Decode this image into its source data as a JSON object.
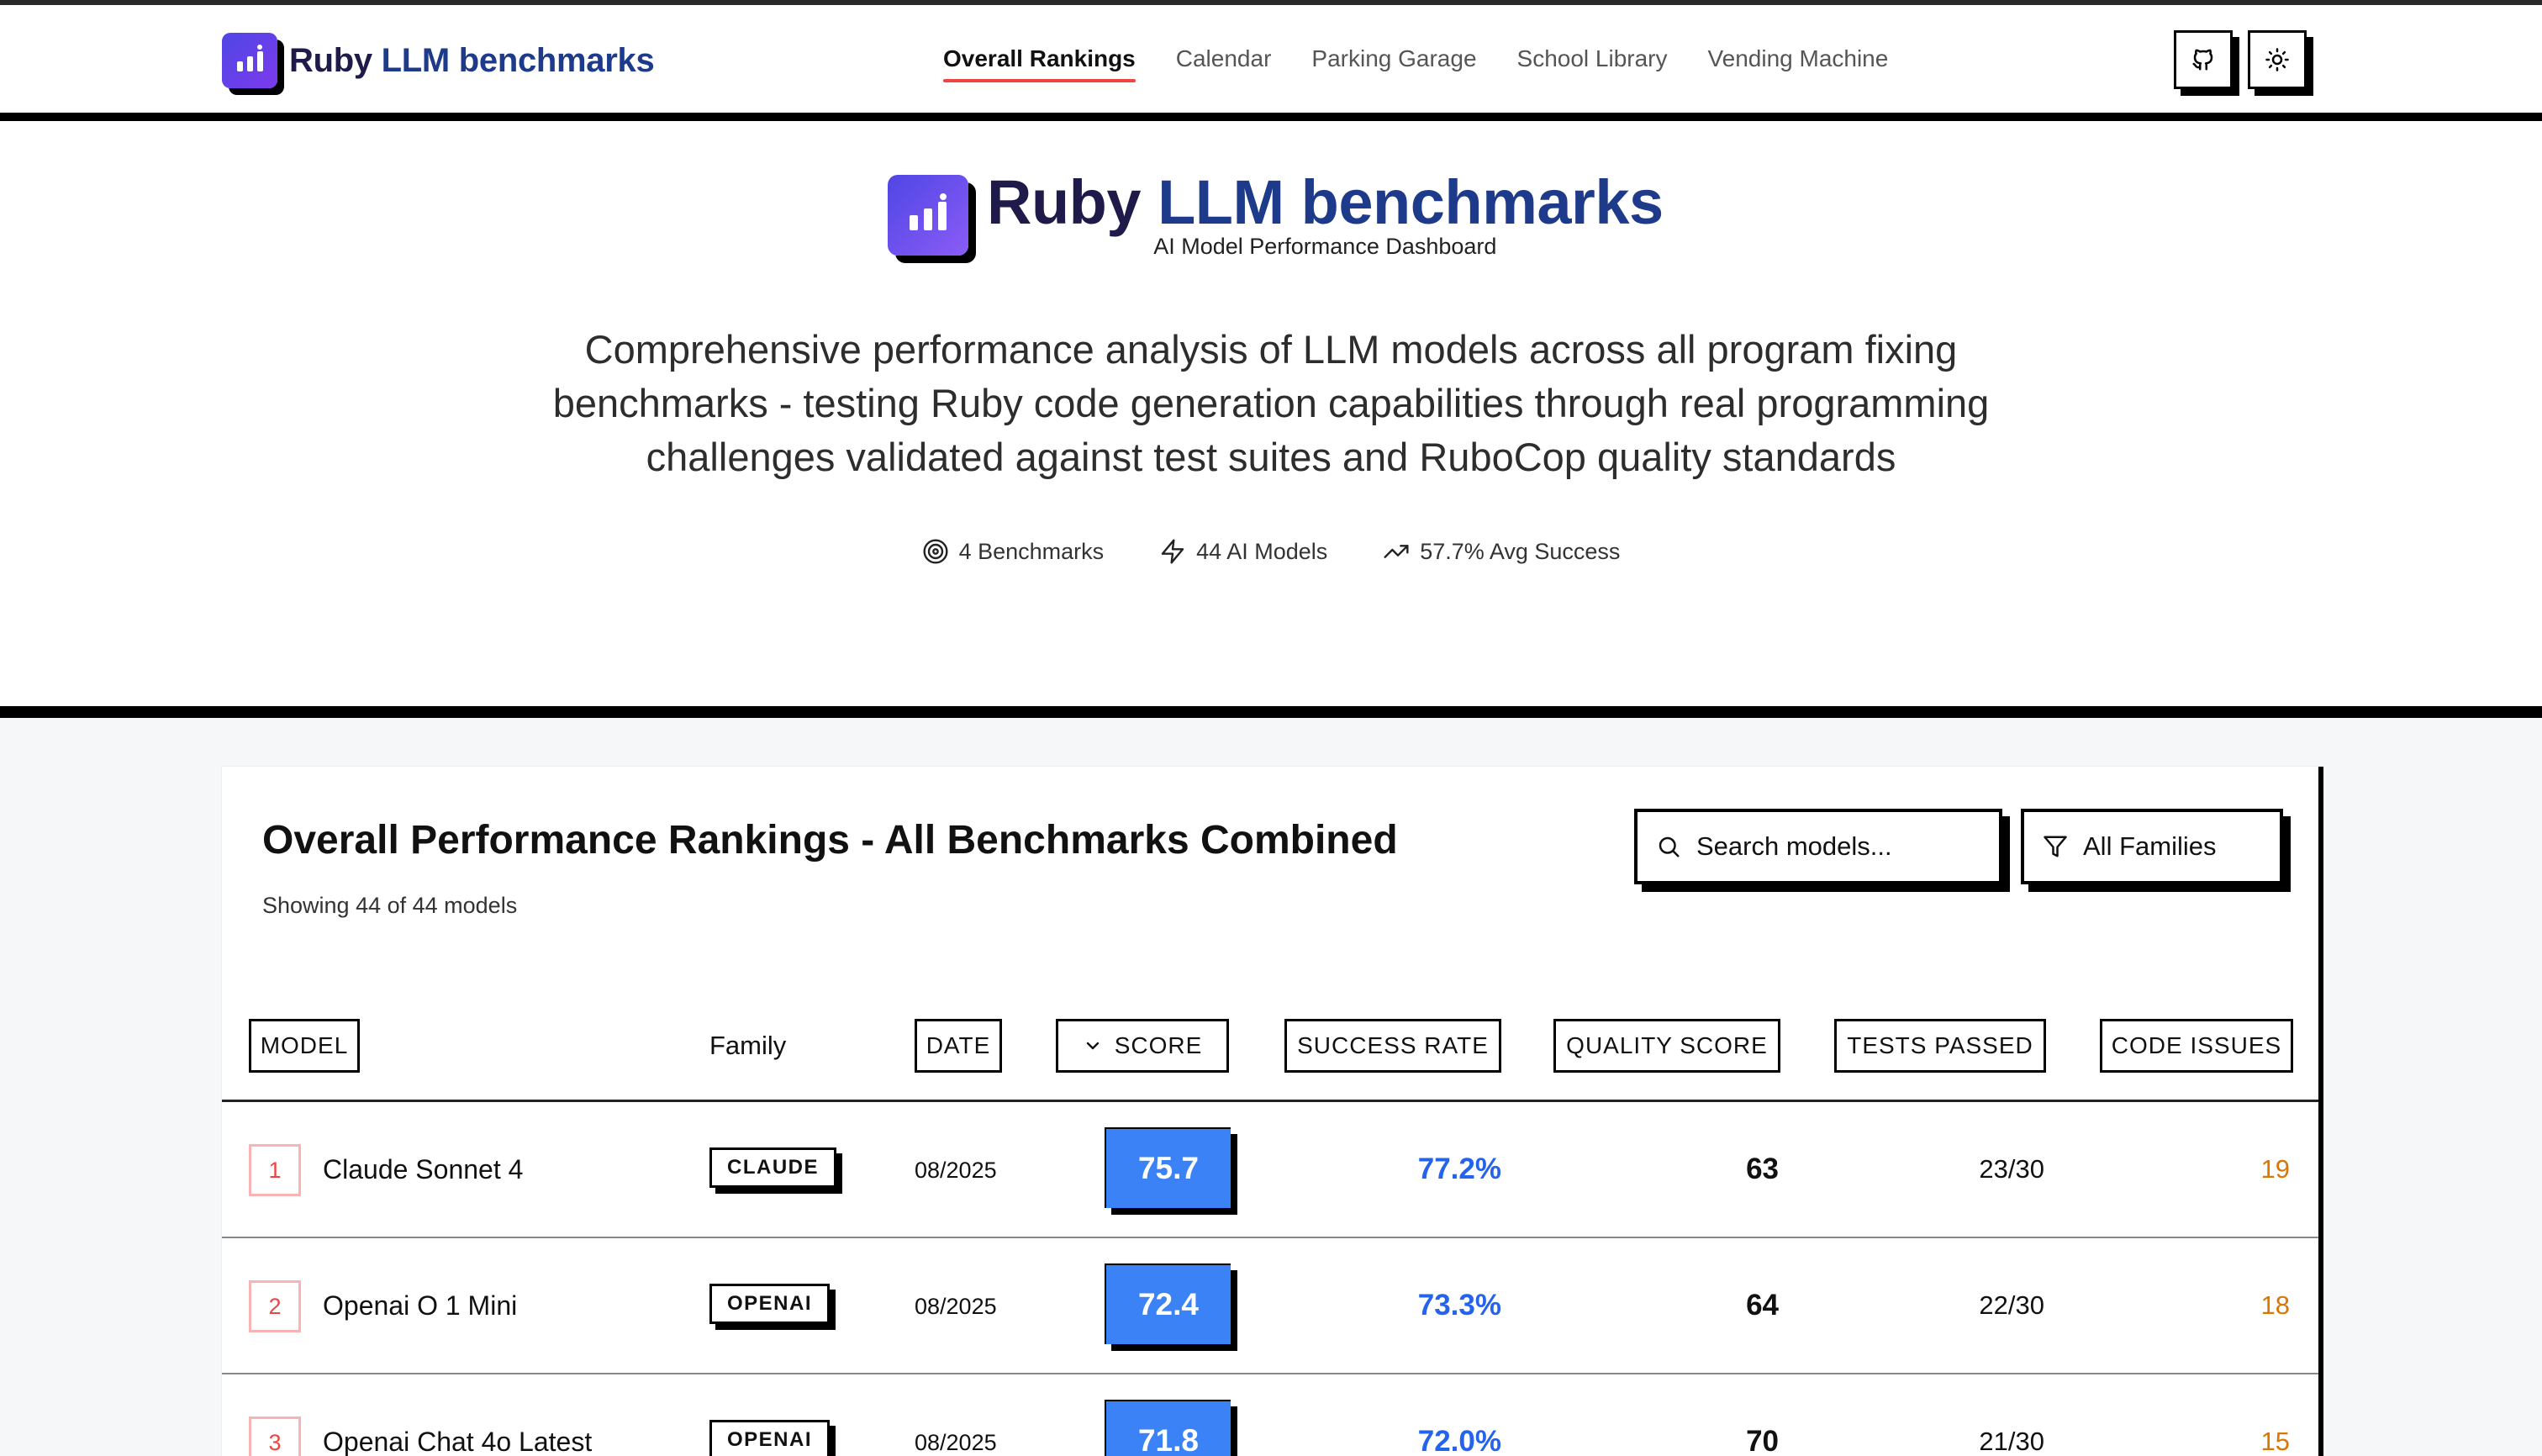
{
  "nav": {
    "brand_word1": "Ruby",
    "brand_word2": "LLM benchmarks",
    "links": [
      {
        "label": "Overall Rankings",
        "active": true
      },
      {
        "label": "Calendar",
        "active": false
      },
      {
        "label": "Parking Garage",
        "active": false
      },
      {
        "label": "School Library",
        "active": false
      },
      {
        "label": "Vending Machine",
        "active": false
      }
    ],
    "github_icon": "github-icon",
    "theme_icon": "sun-icon"
  },
  "hero": {
    "title_word1": "Ruby",
    "title_word2": "LLM benchmarks",
    "subtitle": "AI Model Performance Dashboard",
    "description": "Comprehensive performance analysis of LLM models across all program fixing benchmarks - testing Ruby code generation capabilities through real programming challenges validated against test suites and RuboCop quality standards",
    "stats": [
      {
        "icon": "target-icon",
        "label": "4 Benchmarks"
      },
      {
        "icon": "zap-icon",
        "label": "44 AI Models"
      },
      {
        "icon": "trending-up-icon",
        "label": "57.7% Avg Success"
      }
    ]
  },
  "rankings": {
    "title": "Overall Performance Rankings - All Benchmarks Combined",
    "count_text": "Showing 44 of 44 models",
    "search_placeholder": "Search models...",
    "filter_label": "All Families",
    "columns": {
      "model": "MODEL",
      "family": "Family",
      "date": "DATE",
      "score": "SCORE",
      "success_rate": "SUCCESS RATE",
      "quality_score": "QUALITY SCORE",
      "tests_passed": "TESTS PASSED",
      "code_issues": "CODE ISSUES"
    },
    "rows": [
      {
        "rank": "1",
        "model": "Claude Sonnet 4",
        "family": "CLAUDE",
        "date": "08/2025",
        "score": "75.7",
        "success_rate": "77.2%",
        "quality_score": "63",
        "tests_passed": "23/30",
        "code_issues": "19"
      },
      {
        "rank": "2",
        "model": "Openai O 1 Mini",
        "family": "OPENAI",
        "date": "08/2025",
        "score": "72.4",
        "success_rate": "73.3%",
        "quality_score": "64",
        "tests_passed": "22/30",
        "code_issues": "18"
      },
      {
        "rank": "3",
        "model": "Openai Chat 4o Latest",
        "family": "OPENAI",
        "date": "08/2025",
        "score": "71.8",
        "success_rate": "72.0%",
        "quality_score": "70",
        "tests_passed": "21/30",
        "code_issues": "15"
      }
    ]
  },
  "colors": {
    "accent_red": "#ef4444",
    "score_blue": "#3b82f6",
    "success_blue": "#2563eb",
    "issues_orange": "#d97706",
    "brand_navy": "#1e1b4b",
    "brand_blue": "#1e3a8a"
  }
}
